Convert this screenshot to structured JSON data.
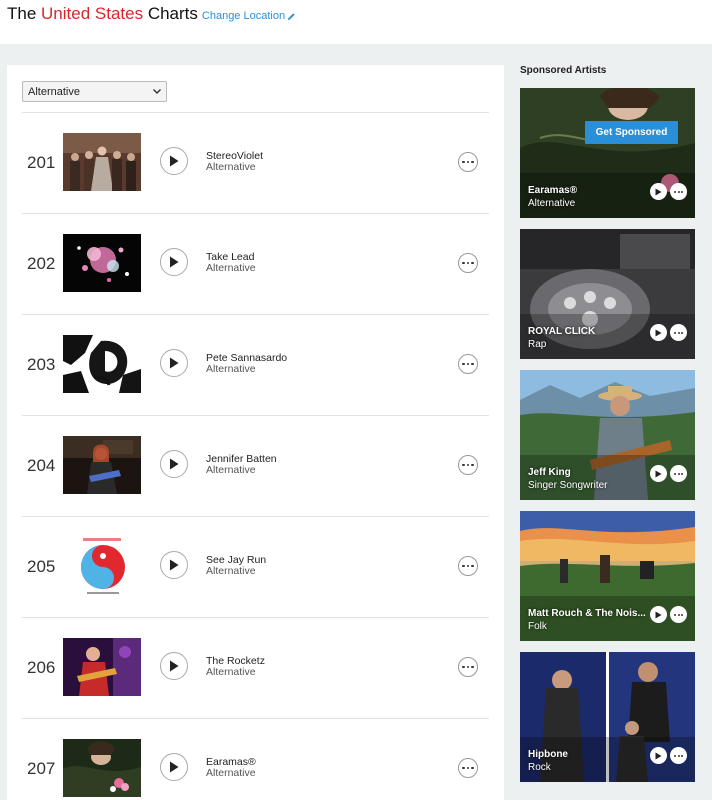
{
  "header": {
    "title_prefix": "The ",
    "title_accent": "United States",
    "title_suffix": " Charts",
    "change_location": "Change Location",
    "accent_color": "#d8262e",
    "link_color": "#2a90d6"
  },
  "filter": {
    "selected": "Alternative"
  },
  "chart": {
    "rows": [
      {
        "rank": "201",
        "name": "StereoViolet",
        "genre": "Alternative"
      },
      {
        "rank": "202",
        "name": "Take Lead",
        "genre": "Alternative"
      },
      {
        "rank": "203",
        "name": "Pete Sannasardo",
        "genre": "Alternative"
      },
      {
        "rank": "204",
        "name": "Jennifer Batten",
        "genre": "Alternative"
      },
      {
        "rank": "205",
        "name": "See Jay Run",
        "genre": "Alternative"
      },
      {
        "rank": "206",
        "name": "The Rocketz",
        "genre": "Alternative"
      },
      {
        "rank": "207",
        "name": "Earamas®",
        "genre": "Alternative"
      }
    ]
  },
  "sidebar": {
    "title": "Sponsored Artists",
    "get_sponsored": "Get Sponsored",
    "cards": [
      {
        "name": "Earamas®",
        "genre": "Alternative"
      },
      {
        "name": "ROYAL CLICK",
        "genre": "Rap"
      },
      {
        "name": "Jeff King",
        "genre": "Singer Songwriter"
      },
      {
        "name": "Matt Rouch & The Nois...",
        "genre": "Folk"
      },
      {
        "name": "Hipbone",
        "genre": "Rock"
      }
    ]
  }
}
